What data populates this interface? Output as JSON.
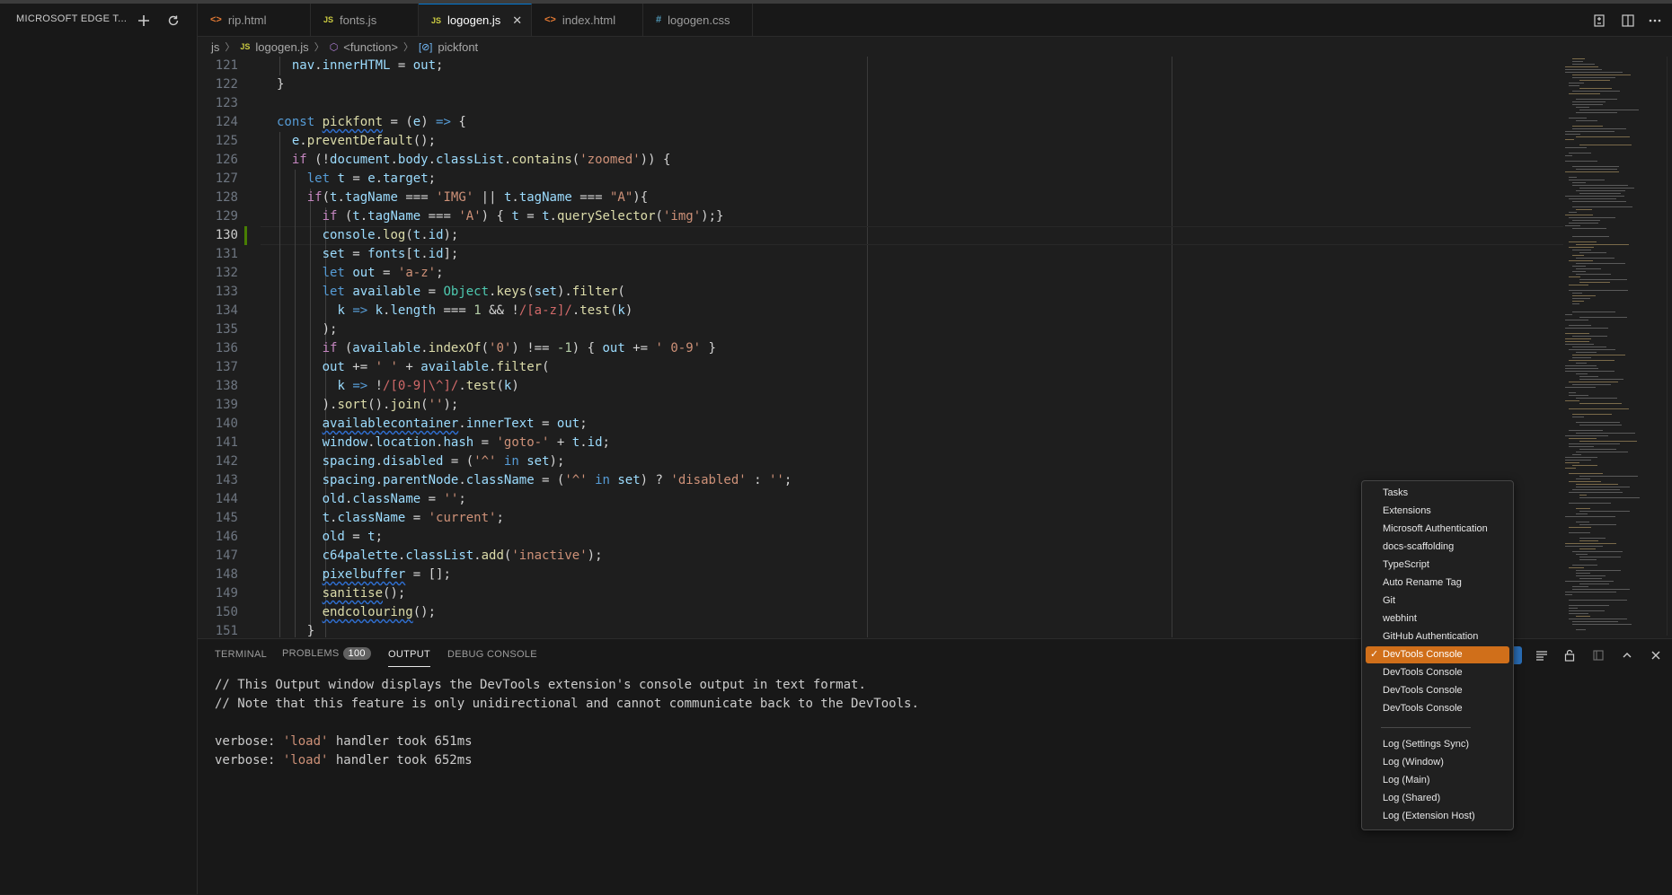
{
  "sidebar": {
    "title": "MICROSOFT EDGE T..."
  },
  "tabs": [
    {
      "label": "rip.html",
      "icon": "html-file-icon",
      "active": false
    },
    {
      "label": "fonts.js",
      "icon": "js-file-icon",
      "active": false
    },
    {
      "label": "logogen.js",
      "icon": "js-file-icon",
      "active": true
    },
    {
      "label": "index.html",
      "icon": "html-file-icon",
      "active": false
    },
    {
      "label": "logogen.css",
      "icon": "css-file-icon",
      "active": false
    }
  ],
  "breadcrumb": {
    "folder": "js",
    "file": "logogen.js",
    "scope": "<function>",
    "symbol": "pickfont"
  },
  "editor": {
    "line_numbers": [
      "121",
      "122",
      "123",
      "124",
      "125",
      "126",
      "127",
      "128",
      "129",
      "130",
      "131",
      "132",
      "133",
      "134",
      "135",
      "136",
      "137",
      "138",
      "139",
      "140",
      "141",
      "142",
      "143",
      "144",
      "145",
      "146",
      "147",
      "148",
      "149",
      "150",
      "151"
    ],
    "current_line": "130"
  },
  "panel": {
    "tabs": {
      "terminal": "TERMINAL",
      "problems": "PROBLEMS",
      "problems_count": "100",
      "output": "OUTPUT",
      "debug_console": "DEBUG CONSOLE"
    },
    "output_lines": [
      "// This Output window displays the DevTools extension's console output in text format.",
      "// Note that this feature is only unidirectional and cannot communicate back to the DevTools.",
      "",
      "verbose:",
      "verbose:"
    ],
    "verbose": [
      {
        "prefix": "verbose: ",
        "str": "'load'",
        "rest": " handler took 651ms"
      },
      {
        "prefix": "verbose: ",
        "str": "'load'",
        "rest": " handler took 652ms"
      }
    ]
  },
  "output_channels": {
    "items": [
      "Tasks",
      "Extensions",
      "Microsoft Authentication",
      "docs-scaffolding",
      "TypeScript",
      "Auto Rename Tag",
      "Git",
      "webhint",
      "GitHub Authentication",
      "DevTools Console",
      "DevTools Console",
      "DevTools Console",
      "DevTools Console"
    ],
    "selected": "DevTools Console",
    "check": "✓",
    "log_items": [
      "Log (Settings Sync)",
      "Log (Window)",
      "Log (Main)",
      "Log (Shared)",
      "Log (Extension Host)"
    ]
  },
  "colors": {
    "accent": "#d06f1a",
    "background": "#1e1e1e",
    "active_tab_border": "#0078d4"
  }
}
